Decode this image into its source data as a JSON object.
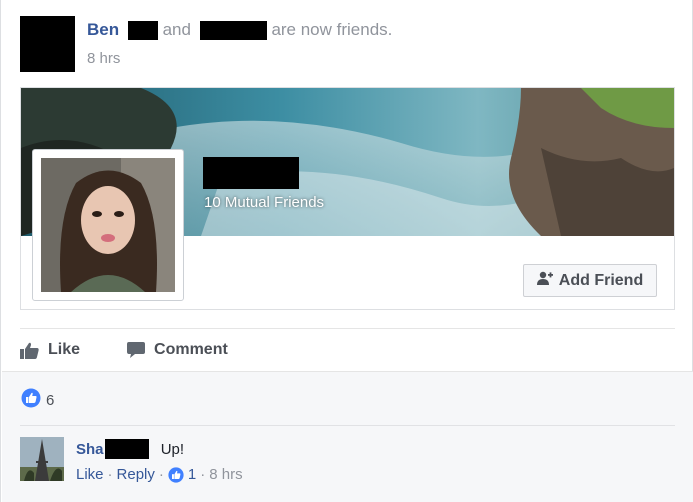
{
  "story": {
    "actor": "Ben",
    "connector": "and",
    "action": "are now friends.",
    "time": "8 hrs"
  },
  "card": {
    "mutual_friends": "10 Mutual Friends",
    "add_friend_label": "Add Friend",
    "add_friend_icon": "add-friend-icon"
  },
  "actions": {
    "like_label": "Like",
    "like_icon": "thumbs-up-icon",
    "comment_label": "Comment",
    "comment_icon": "speech-bubble-icon"
  },
  "reactions": {
    "count": "6",
    "icon": "like-reaction-icon"
  },
  "comment": {
    "author_prefix": "Sha",
    "text": "Up!",
    "like_link": "Like",
    "reply_link": "Reply",
    "like_count": "1",
    "time": "8 hrs",
    "separator": "·"
  },
  "colors": {
    "link_blue": "#365899",
    "like_blue": "#4080ff",
    "muted": "#90949c"
  }
}
